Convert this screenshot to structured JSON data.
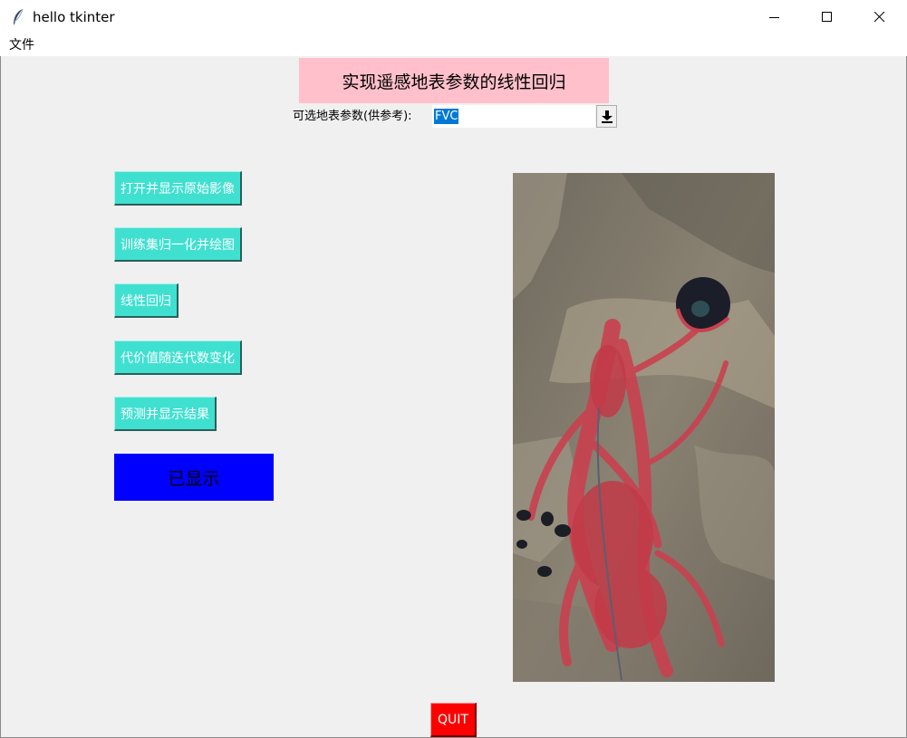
{
  "window": {
    "title": "hello tkinter",
    "controls": {
      "minimize": "minimize-icon",
      "maximize": "maximize-icon",
      "close": "close-icon"
    }
  },
  "menu": {
    "file_label": "文件"
  },
  "header": {
    "title": "实现遥感地表参数的线性回归",
    "bg_color": "#ffc0cb"
  },
  "param_select": {
    "label": "可选地表参数(供参考):",
    "value": "FVC",
    "arrow_icon": "download-arrow-icon"
  },
  "buttons": {
    "open_image": "打开并显示原始影像",
    "normalize_plot": "训练集归一化并绘图",
    "linear_regression": "线性回归",
    "cost_change": "代价值随迭代数变化",
    "predict_show": "预测并显示结果",
    "color": "#40e0d0"
  },
  "status": {
    "text": "已显示",
    "bg_color": "#0000ff"
  },
  "quit": {
    "label": "QUIT",
    "bg_color": "#ff0000"
  },
  "image": {
    "name": "remote-sensing-false-color-image"
  }
}
